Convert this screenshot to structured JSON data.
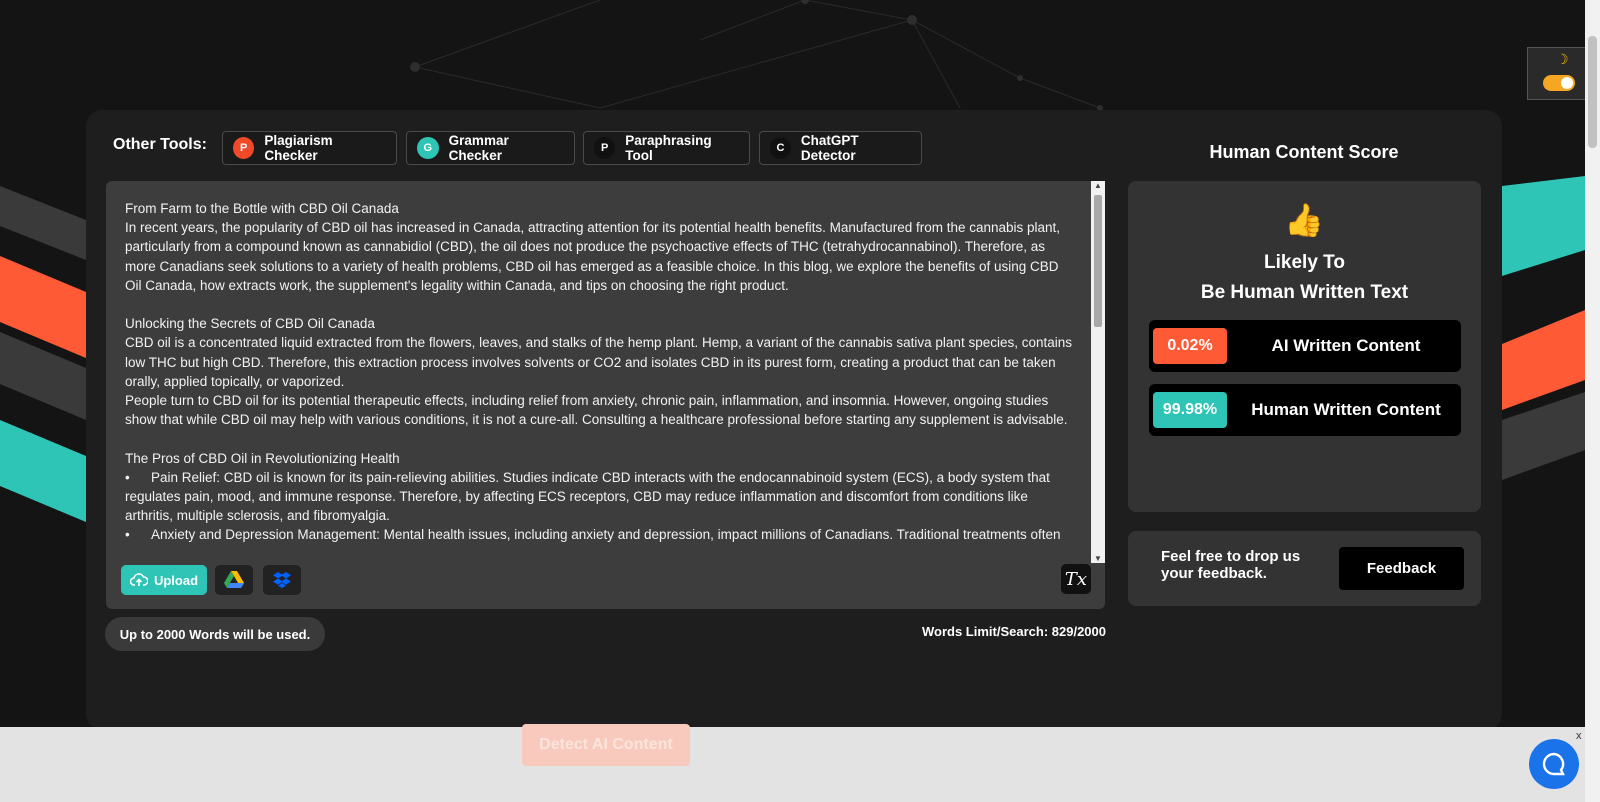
{
  "colors": {
    "accent_teal": "#2ec4b6",
    "accent_orange": "#ff5a36",
    "panel": "#1e1e1e"
  },
  "tools": {
    "label": "Other Tools:",
    "items": [
      {
        "label": "Plagiarism Checker",
        "icon_letter": "P",
        "color": "#f04a2a"
      },
      {
        "label": "Grammar Checker",
        "icon_letter": "G",
        "color": "#2ec4b6"
      },
      {
        "label": "Paraphrasing Tool",
        "icon_letter": "P",
        "color": "#111111"
      },
      {
        "label": "ChatGPT Detector",
        "icon_letter": "C",
        "color": "#111111"
      }
    ]
  },
  "editor": {
    "lines": [
      "From Farm to the Bottle with CBD Oil Canada",
      "In recent years, the popularity of CBD oil has increased in Canada, attracting attention for its potential health benefits. Manufactured from the cannabis plant, particularly from a compound known as cannabidiol (CBD), the oil does not produce the psychoactive effects of THC (tetrahydrocannabinol). Therefore, as more Canadians seek solutions to a variety of health problems, CBD oil has emerged as a feasible choice. In this blog, we explore the benefits of using CBD Oil Canada, how extracts work, the supplement's legality within Canada, and tips on choosing the right product.",
      "",
      "Unlocking the Secrets of CBD Oil Canada",
      "CBD oil is a concentrated liquid extracted from the flowers, leaves, and stalks of the hemp plant. Hemp, a variant of the cannabis sativa plant species, contains low THC but high CBD. Therefore, this extraction process involves solvents or CO2 and isolates CBD in its purest form, creating a product that can be taken orally, applied topically, or vaporized.",
      "People turn to CBD oil for its potential therapeutic effects, including relief from anxiety, chronic pain, inflammation, and insomnia. However, ongoing studies show that while CBD oil may help with various conditions, it is not a cure-all. Consulting a healthcare professional before starting any supplement is advisable.",
      "",
      "The Pros of CBD Oil in Revolutionizing Health"
    ],
    "bullets": [
      "Pain Relief: CBD oil is known for its pain-relieving abilities. Studies indicate CBD interacts with the endocannabinoid system (ECS), a body system that regulates pain, mood, and immune response. Therefore, by affecting ECS receptors, CBD may reduce inflammation and discomfort from conditions like arthritis, multiple sclerosis, and fibromyalgia.",
      "Anxiety and Depression Management: Mental health issues, including anxiety and depression, impact millions of Canadians. Traditional treatments often"
    ],
    "bullet_symbol": "•",
    "upload_label": "Upload",
    "clear_symbol": "Tx"
  },
  "words_note": "Up to 2000 Words will be used.",
  "words_count": "Words Limit/Search: 829/2000",
  "score": {
    "title": "Human Content Score",
    "icon": "👍",
    "verdict_line1": "Likely To",
    "verdict_line2": "Be Human Written Text",
    "ai_pct": "0.02%",
    "ai_label": "AI Written Content",
    "ai_pct_value": 0.02,
    "human_pct": "99.98%",
    "human_label": "Human Written Content",
    "human_pct_value": 99.98
  },
  "feedback": {
    "text": "Feel free to drop us your feedback.",
    "button": "Feedback"
  },
  "detect_button": "Detect AI Content",
  "theme_toggle": {
    "moon": "☽",
    "state": "dark"
  },
  "close_symbol": "x"
}
